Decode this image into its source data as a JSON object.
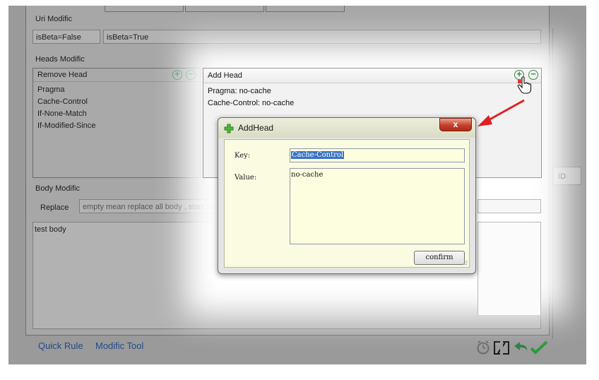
{
  "uri_modific": {
    "label": "Uri Modific",
    "from_value": "isBeta=False",
    "to_value": "isBeta=True"
  },
  "heads_modific": {
    "label": "Heads Modific",
    "remove_head": {
      "title": "Remove Head",
      "items": [
        "Pragma",
        "Cache-Control",
        "If-None-Match",
        "If-Modified-Since"
      ]
    },
    "add_head": {
      "title": "Add Head",
      "items": [
        "Pragma: no-cache",
        "Cache-Control: no-cache"
      ]
    },
    "add_icon": "+",
    "remove_icon": "−"
  },
  "body_modific": {
    "label": "Body Modific",
    "replace_label": "Replace",
    "replace_placeholder": "empty mean replace all body , start with",
    "body_text": "test body"
  },
  "side": {
    "id_header": "ID"
  },
  "dialog": {
    "title": "AddHead",
    "close_label": "x",
    "key_label": "Key:",
    "key_value": "Cache-Control",
    "value_label": "Value:",
    "value_text": "no-cache",
    "confirm_label": "confirm"
  },
  "bottom": {
    "quick_rule": "Quick Rule",
    "modific_tool": "Modific Tool"
  },
  "colors": {
    "accent_green": "#3a8a4a",
    "link_blue": "#234a8a",
    "selection_blue": "#3873c6",
    "arrow_red": "#e02020",
    "close_red": "#c4402a"
  }
}
